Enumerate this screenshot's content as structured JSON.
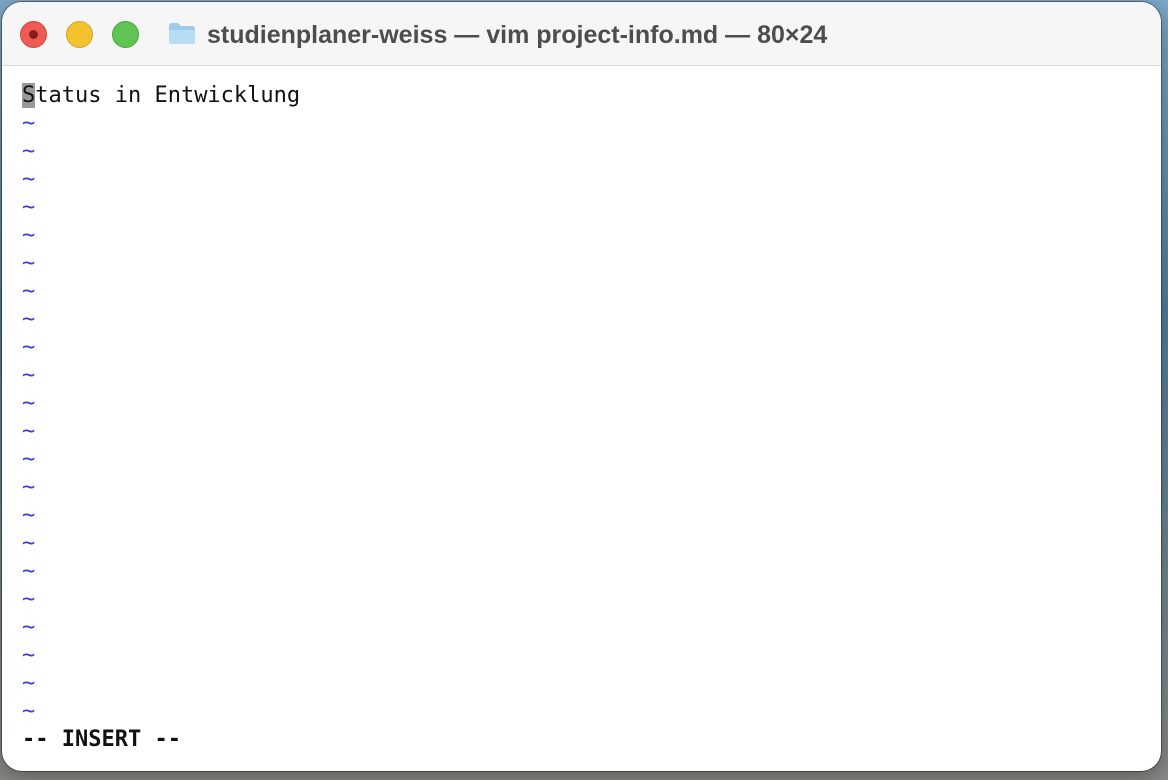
{
  "window": {
    "title": "studienplaner-weiss — vim project-info.md — 80×24"
  },
  "editor": {
    "cursor_char": "S",
    "first_line_rest": "tatus in Entwicklung",
    "empty_line_marker": "~",
    "mode_indicator": "-- INSERT --"
  },
  "colors": {
    "tilde": "#3b3bd8",
    "close": "#ee5b55",
    "minimize": "#f4c12f",
    "zoom": "#5fc453"
  },
  "icons": {
    "folder": "folder-icon",
    "close": "close-button",
    "minimize": "minimize-button",
    "zoom": "zoom-button"
  }
}
